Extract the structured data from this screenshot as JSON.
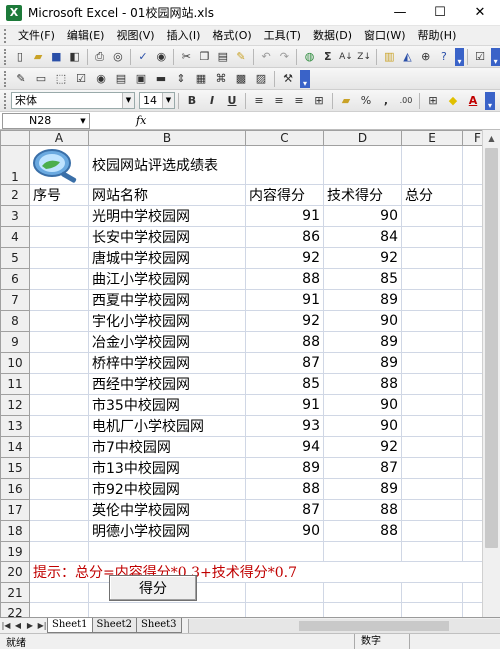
{
  "window": {
    "title": "Microsoft Excel - 01校园网站.xls",
    "app_icon": "X",
    "min": "—",
    "max": "☐",
    "close": "✕"
  },
  "menu": {
    "items": [
      "文件(F)",
      "编辑(E)",
      "视图(V)",
      "插入(I)",
      "格式(O)",
      "工具(T)",
      "数据(D)",
      "窗口(W)",
      "帮助(H)"
    ]
  },
  "format": {
    "font_name": "宋体",
    "font_size": "14",
    "bold": "B",
    "italic": "I",
    "underline": "U",
    "percent": "%",
    "comma": ",",
    "inc_decimal": ".00"
  },
  "formula": {
    "cell_ref": "N28",
    "fx": "fx",
    "value": ""
  },
  "columns": [
    "A",
    "B",
    "C",
    "D",
    "E",
    "F"
  ],
  "sheet": {
    "title": "校园网站评选成绩表",
    "headers": [
      "序号",
      "网站名称",
      "内容得分",
      "技术得分",
      "总分"
    ],
    "rows": [
      {
        "name": "光明中学校园网",
        "content": 91,
        "tech": 90
      },
      {
        "name": "长安中学校园网",
        "content": 86,
        "tech": 84
      },
      {
        "name": "唐城中学校园网",
        "content": 92,
        "tech": 92
      },
      {
        "name": "曲江小学校园网",
        "content": 88,
        "tech": 85
      },
      {
        "name": "西夏中学校园网",
        "content": 91,
        "tech": 89
      },
      {
        "name": "宇化小学校园网",
        "content": 92,
        "tech": 90
      },
      {
        "name": "冶金小学校园网",
        "content": 88,
        "tech": 89
      },
      {
        "name": "桥梓中学校园网",
        "content": 87,
        "tech": 89
      },
      {
        "name": "西经中学校园网",
        "content": 85,
        "tech": 88
      },
      {
        "name": "市35中校园网",
        "content": 91,
        "tech": 90
      },
      {
        "name": "电机厂小学校园网",
        "content": 93,
        "tech": 90
      },
      {
        "name": "市7中校园网",
        "content": 94,
        "tech": 92
      },
      {
        "name": "市13中校园网",
        "content": 89,
        "tech": 87
      },
      {
        "name": "市92中校园网",
        "content": 88,
        "tech": 89
      },
      {
        "name": "英伦中学校园网",
        "content": 87,
        "tech": 88
      },
      {
        "name": "明德小学校园网",
        "content": 90,
        "tech": 88
      }
    ],
    "hint": "提示：总分=内容得分*0.3+技术得分*0.7",
    "button_label": "得分",
    "row_numbers": [
      "1",
      "2",
      "3",
      "4",
      "5",
      "6",
      "7",
      "8",
      "9",
      "10",
      "11",
      "12",
      "13",
      "14",
      "15",
      "16",
      "17",
      "18",
      "19",
      "20",
      "21",
      "22"
    ]
  },
  "tabs": [
    "Sheet1",
    "Sheet2",
    "Sheet3"
  ],
  "status": {
    "ready": "就绪",
    "num": "数字"
  }
}
